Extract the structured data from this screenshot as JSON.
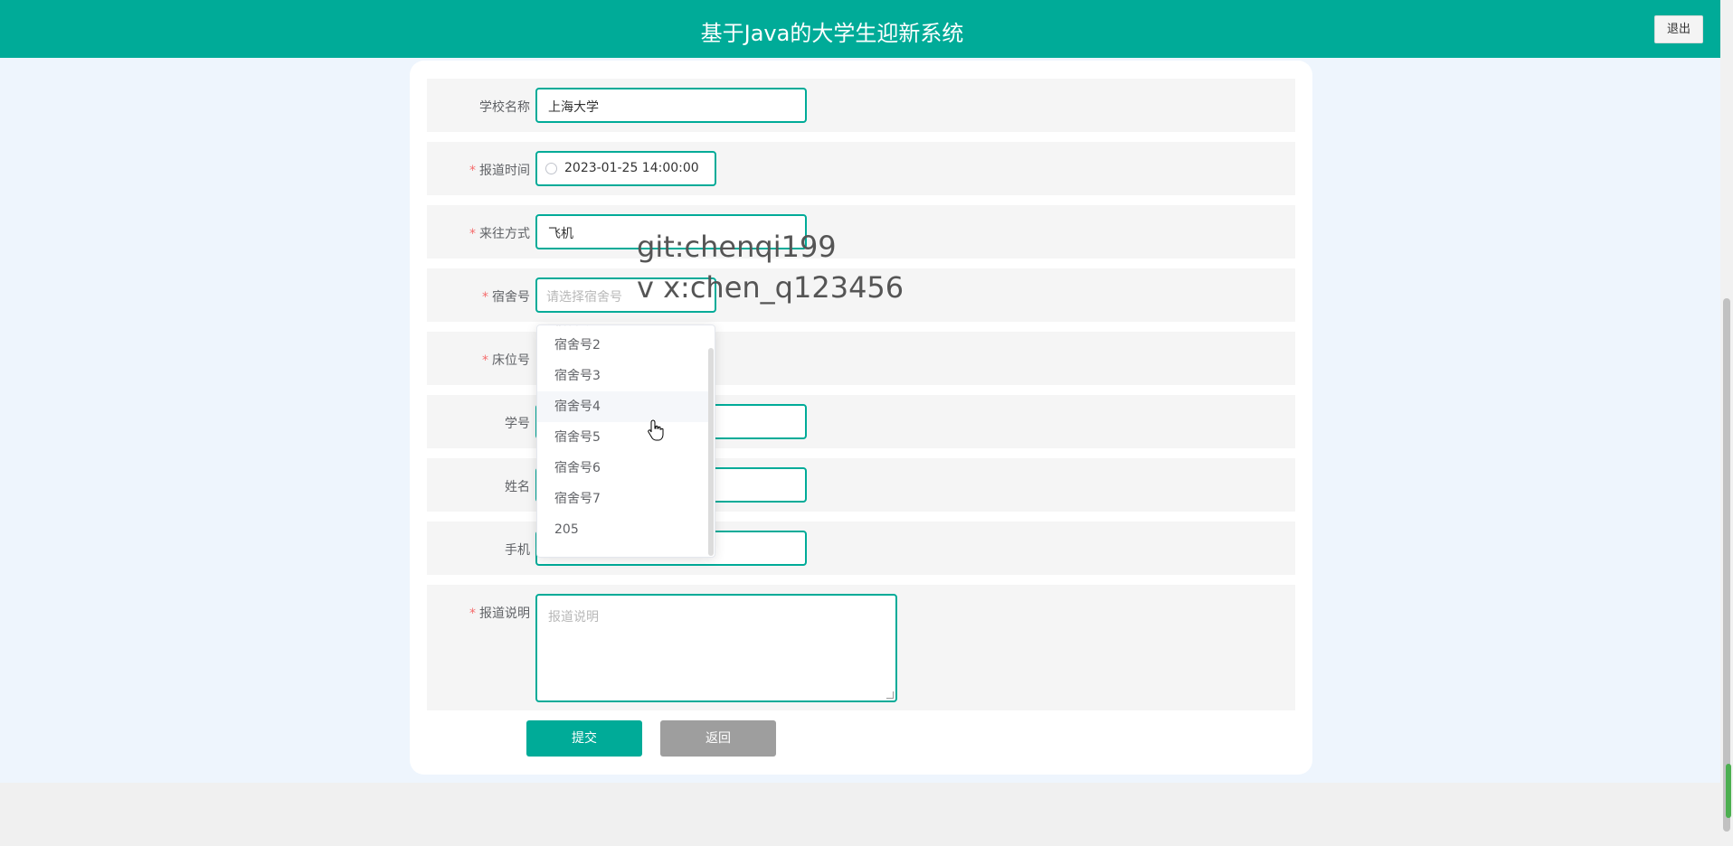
{
  "header": {
    "title": "基于Java的大学生迎新系统",
    "logout_label": "退出",
    "bg_color": "#00ab98"
  },
  "form": {
    "school_name": {
      "label": "学校名称",
      "value": "上海大学",
      "required": false
    },
    "report_time": {
      "label": "报道时间",
      "value": "2023-01-25 14:00:00",
      "required": true,
      "icon": "clock-icon"
    },
    "transport": {
      "label": "来往方式",
      "value": "飞机",
      "required": true
    },
    "dorm": {
      "label": "宿舍号",
      "placeholder": "请选择宿舍号",
      "required": true
    },
    "bed": {
      "label": "床位号",
      "required": true
    },
    "student_id": {
      "label": "学号",
      "required": false
    },
    "name": {
      "label": "姓名",
      "required": false
    },
    "phone": {
      "label": "手机",
      "required": false
    },
    "report_note": {
      "label": "报道说明",
      "placeholder": "报道说明",
      "required": true
    }
  },
  "dorm_dropdown": {
    "options": [
      "宿舍号2",
      "宿舍号3",
      "宿舍号4",
      "宿舍号5",
      "宿舍号6",
      "宿舍号7",
      "205"
    ],
    "hovered": "宿舍号4"
  },
  "buttons": {
    "submit_label": "提交",
    "back_label": "返回",
    "submit_color": "#00ab98",
    "back_color": "#9e9e9e"
  },
  "watermark": {
    "line1": "git:chenqi199",
    "line2": "v x:chen_q123456"
  }
}
